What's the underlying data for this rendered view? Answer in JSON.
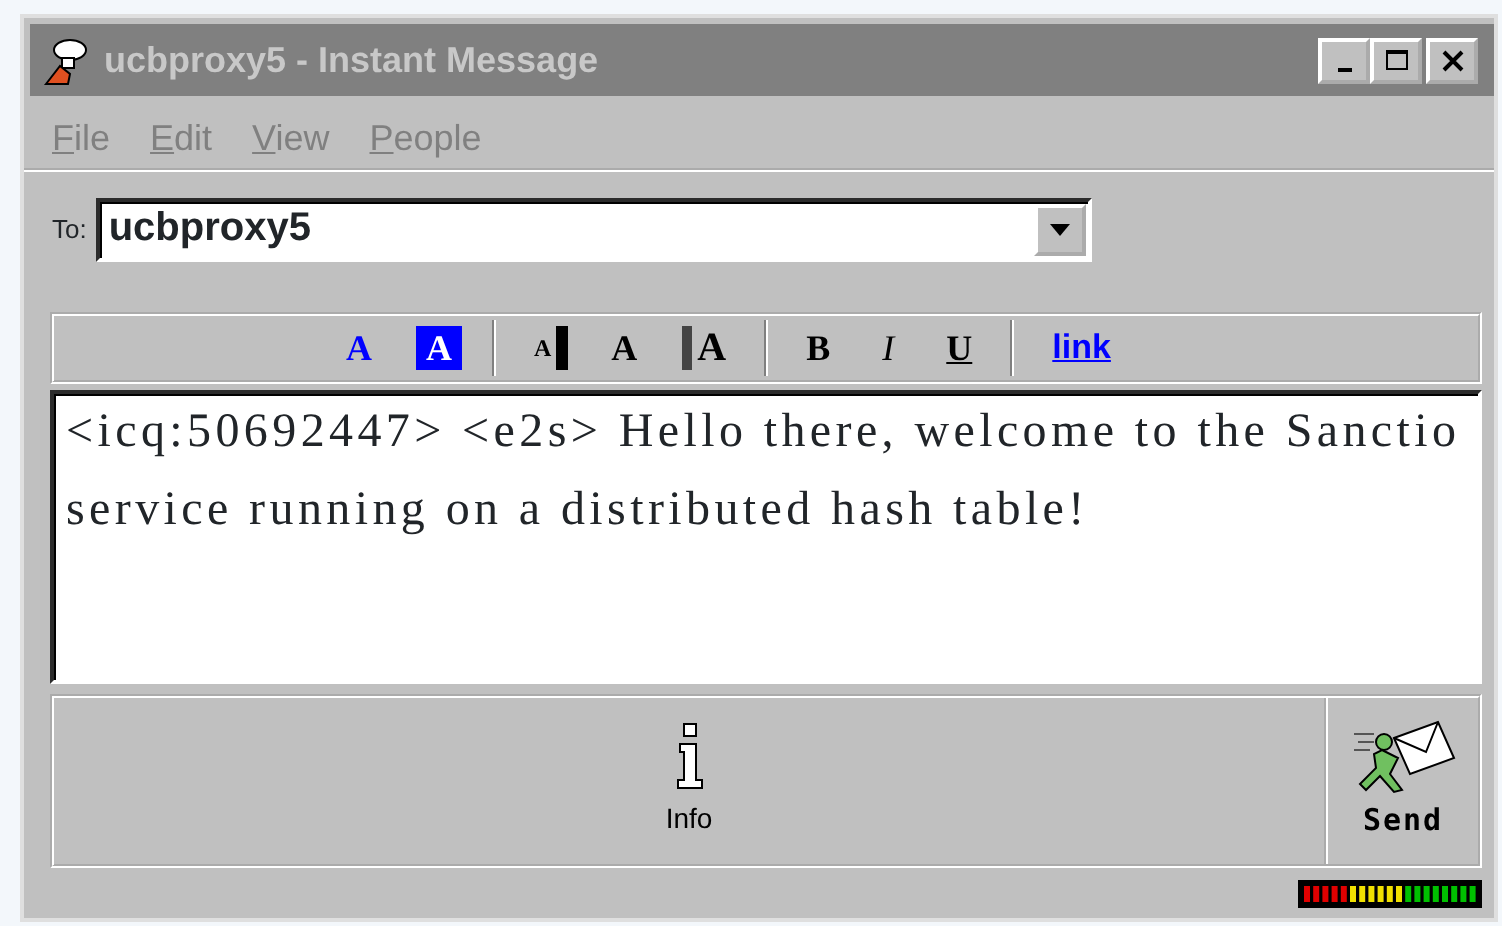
{
  "window": {
    "title": "ucbproxy5 - Instant Message"
  },
  "menu": [
    {
      "label": "File",
      "disabled": true
    },
    {
      "label": "Edit",
      "disabled": true
    },
    {
      "label": "View",
      "disabled": true
    },
    {
      "label": "People",
      "disabled": true
    }
  ],
  "to": {
    "label": "To:",
    "value": "ucbproxy5"
  },
  "format_toolbar": [
    {
      "kind": "color",
      "label": "A"
    },
    {
      "kind": "highlight",
      "label": "A"
    },
    {
      "kind": "separator"
    },
    {
      "kind": "smaller",
      "label": "A"
    },
    {
      "kind": "normal",
      "label": "A"
    },
    {
      "kind": "bigger",
      "label": "A"
    },
    {
      "kind": "separator"
    },
    {
      "kind": "bold",
      "label": "B"
    },
    {
      "kind": "italic",
      "label": "I"
    },
    {
      "kind": "underline",
      "label": "U"
    },
    {
      "kind": "separator"
    },
    {
      "kind": "link",
      "label": "link"
    }
  ],
  "message": "<icq:50692447> <e2s> Hello there, welcome to the Sanctio service running on a distributed hash table!",
  "buttons": [
    {
      "kind": "info",
      "label": "Info"
    },
    {
      "kind": "send",
      "label": "Send"
    }
  ]
}
